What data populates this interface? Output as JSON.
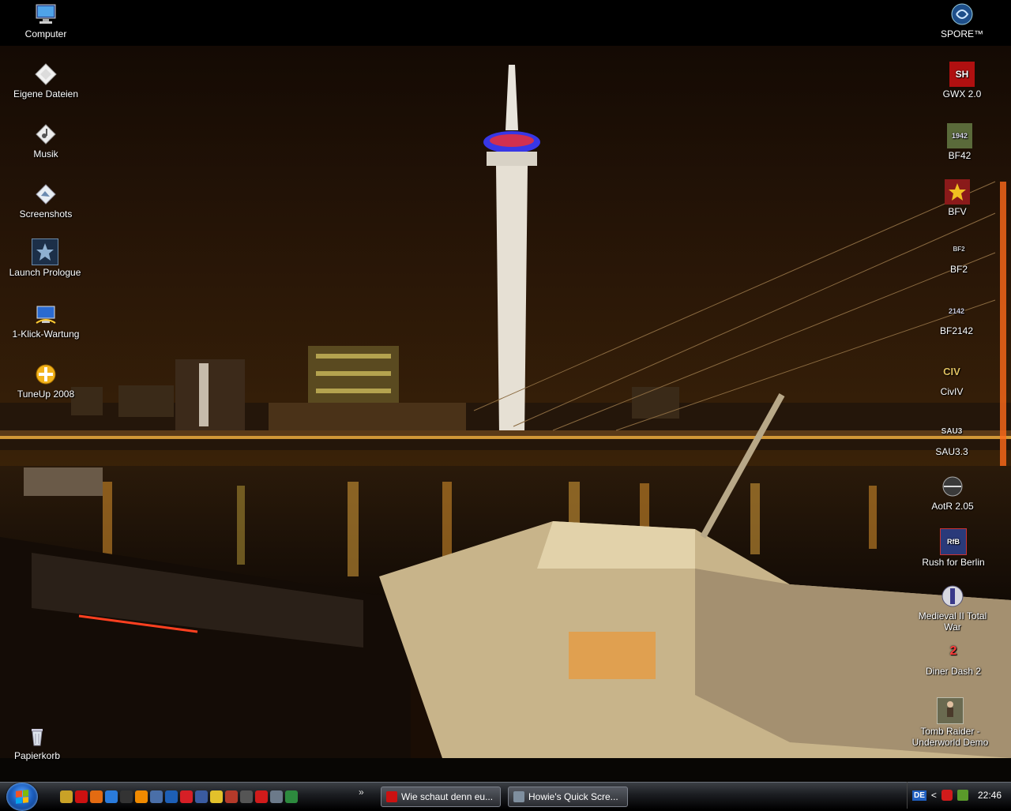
{
  "desktop": {
    "left_icons": [
      {
        "label": "Computer",
        "icon": "computer-icon"
      },
      {
        "label": "Eigene Dateien",
        "icon": "documents-icon"
      },
      {
        "label": "Musik",
        "icon": "music-folder-icon"
      },
      {
        "label": "Screenshots",
        "icon": "pictures-folder-icon"
      },
      {
        "label": "Launch Prologue",
        "icon": "saga-icon"
      },
      {
        "label": "1-Klick-Wartung",
        "icon": "maintenance-icon"
      },
      {
        "label": "TuneUp 2008",
        "icon": "tuneup-icon"
      },
      {
        "label": "Papierkorb",
        "icon": "recycle-bin-icon"
      }
    ],
    "right_icons": [
      {
        "label": "SPORE™",
        "icon": "spore-icon"
      },
      {
        "label": "GWX 2.0",
        "icon": "gwx-icon"
      },
      {
        "label": "BF42",
        "icon": "bf42-icon"
      },
      {
        "label": "BFV",
        "icon": "bfv-icon"
      },
      {
        "label": "BF2",
        "icon": "bf2-icon"
      },
      {
        "label": "BF2142",
        "icon": "bf2142-icon"
      },
      {
        "label": "CivIV",
        "icon": "civ4-icon"
      },
      {
        "label": "SAU3.3",
        "icon": "sau-icon"
      },
      {
        "label": "AotR 2.05",
        "icon": "aotr-icon"
      },
      {
        "label": "Rush for Berlin",
        "icon": "rush-for-berlin-icon"
      },
      {
        "label": "Medieval II Total War",
        "icon": "medieval2-icon"
      },
      {
        "label": "Diner Dash 2",
        "icon": "diner-dash-icon"
      },
      {
        "label": "Tomb Raider - Underworld Demo",
        "icon": "tomb-raider-icon"
      }
    ]
  },
  "taskbar": {
    "quicklaunch": [
      {
        "icon": "show-desktop-icon",
        "color": "#c9a227"
      },
      {
        "icon": "opera-icon",
        "color": "#cc1111"
      },
      {
        "icon": "firefox-icon",
        "color": "#e36b12"
      },
      {
        "icon": "internet-explorer-icon",
        "color": "#2a7bdc"
      },
      {
        "icon": "messenger-icon",
        "color": "#333333"
      },
      {
        "icon": "vlc-icon",
        "color": "#f08a00"
      },
      {
        "icon": "media-center-icon",
        "color": "#4a6fa8"
      },
      {
        "icon": "media-player-icon",
        "color": "#1d5fb6"
      },
      {
        "icon": "canada-flag-icon",
        "color": "#d61f26"
      },
      {
        "icon": "network-icon",
        "color": "#3a5ba0"
      },
      {
        "icon": "smiley-icon",
        "color": "#e2c12b"
      },
      {
        "icon": "game-icon",
        "color": "#b43a2a"
      },
      {
        "icon": "window-icon",
        "color": "#555555"
      },
      {
        "icon": "avira-icon",
        "color": "#d11b1b"
      },
      {
        "icon": "printer-icon",
        "color": "#6c7a8a"
      },
      {
        "icon": "spreadsheet-icon",
        "color": "#2d8a3e"
      }
    ],
    "more_glyph": "»",
    "tasks": [
      {
        "label": "Wie schaut denn eu...",
        "icon": "opera-icon",
        "color": "#cc1111"
      },
      {
        "label": "Howie's Quick Scre...",
        "icon": "screenshot-app-icon",
        "color": "#7f8f9f"
      }
    ],
    "tray": {
      "language": "DE",
      "expand_glyph": "<",
      "clock": "22:46"
    }
  }
}
